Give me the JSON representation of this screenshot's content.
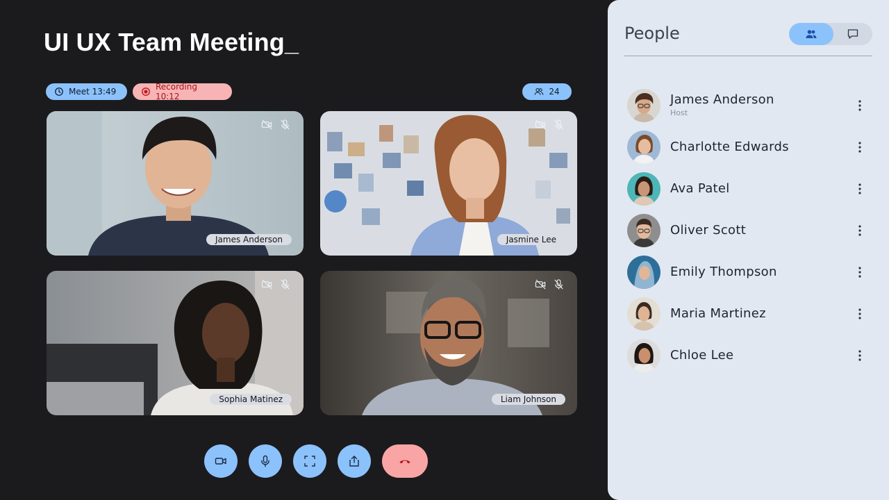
{
  "meeting": {
    "title": "UI UX Team Meeting_",
    "meet_label": "Meet 13:49",
    "recording_label": "Recording 10:12",
    "participant_count": "24"
  },
  "tiles": [
    {
      "name": "James Anderson"
    },
    {
      "name": "Jasmine Lee"
    },
    {
      "name": "Sophia Matinez"
    },
    {
      "name": "Liam Johnson"
    }
  ],
  "controls": [
    "camera",
    "microphone",
    "fullscreen",
    "share",
    "end-call"
  ],
  "panel": {
    "title": "People",
    "people": [
      {
        "name": "James Anderson",
        "role": "Host"
      },
      {
        "name": "Charlotte Edwards"
      },
      {
        "name": "Ava Patel"
      },
      {
        "name": "Oliver Scott"
      },
      {
        "name": "Emily Thompson"
      },
      {
        "name": "Maria Martinez"
      },
      {
        "name": "Chloe Lee"
      }
    ]
  },
  "colors": {
    "background": "#1b1b1e",
    "accent_blue": "#8cc2fb",
    "recording_pink": "#f8b4b4",
    "end_call": "#f9a5a5",
    "panel": "#e2e8f1"
  }
}
